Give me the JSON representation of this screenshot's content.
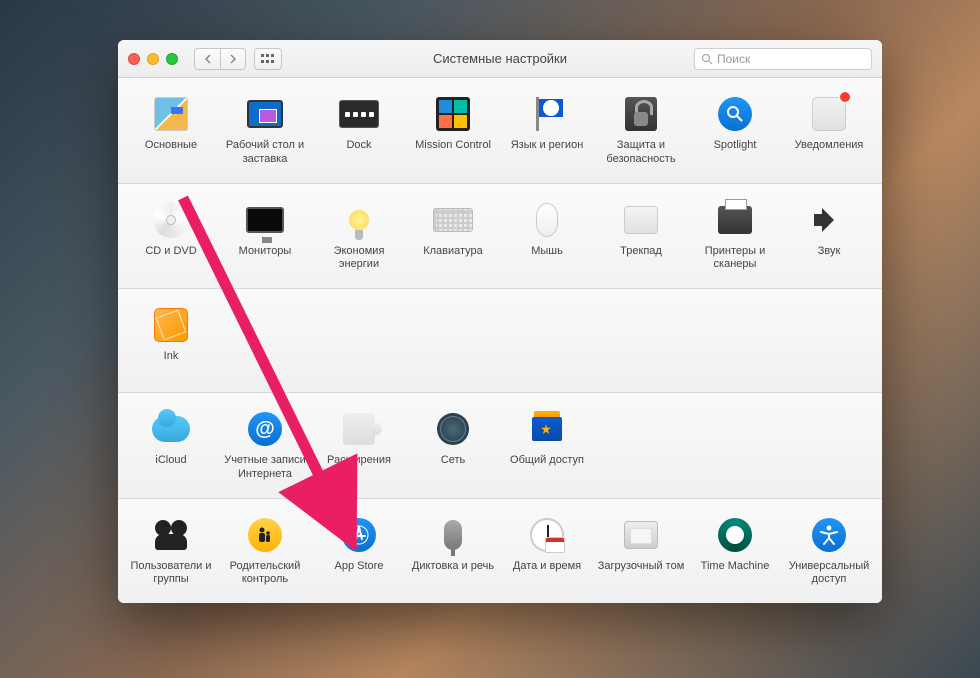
{
  "window_title": "Системные настройки",
  "search_placeholder": "Поиск",
  "rows": [
    [
      {
        "id": "general",
        "label": "Основные"
      },
      {
        "id": "desktop",
        "label": "Рабочий стол и заставка"
      },
      {
        "id": "dock",
        "label": "Dock"
      },
      {
        "id": "mission",
        "label": "Mission Control"
      },
      {
        "id": "language",
        "label": "Язык и регион"
      },
      {
        "id": "security",
        "label": "Защита и безопасность"
      },
      {
        "id": "spotlight",
        "label": "Spotlight"
      },
      {
        "id": "notifications",
        "label": "Уведомления",
        "badge": true
      }
    ],
    [
      {
        "id": "cddvd",
        "label": "CD и DVD"
      },
      {
        "id": "displays",
        "label": "Мониторы"
      },
      {
        "id": "energy",
        "label": "Экономия энергии"
      },
      {
        "id": "keyboard",
        "label": "Клавиатура"
      },
      {
        "id": "mouse",
        "label": "Мышь"
      },
      {
        "id": "trackpad",
        "label": "Трекпад"
      },
      {
        "id": "printers",
        "label": "Принтеры и сканеры"
      },
      {
        "id": "sound",
        "label": "Звук"
      }
    ],
    [
      {
        "id": "ink",
        "label": "Ink"
      }
    ],
    [
      {
        "id": "icloud",
        "label": "iCloud"
      },
      {
        "id": "accounts",
        "label": "Учетные записи Интернета"
      },
      {
        "id": "extensions",
        "label": "Расширения"
      },
      {
        "id": "network",
        "label": "Сеть"
      },
      {
        "id": "sharing",
        "label": "Общий доступ"
      }
    ],
    [
      {
        "id": "users",
        "label": "Пользователи и группы"
      },
      {
        "id": "parental",
        "label": "Родительский контроль"
      },
      {
        "id": "appstore",
        "label": "App Store"
      },
      {
        "id": "dictation",
        "label": "Диктовка и речь"
      },
      {
        "id": "datetime",
        "label": "Дата и время"
      },
      {
        "id": "startup",
        "label": "Загрузочный том"
      },
      {
        "id": "timemachine",
        "label": "Time Machine"
      },
      {
        "id": "accessibility",
        "label": "Универсальный доступ"
      }
    ]
  ],
  "annotation": {
    "arrow_target": "appstore"
  }
}
